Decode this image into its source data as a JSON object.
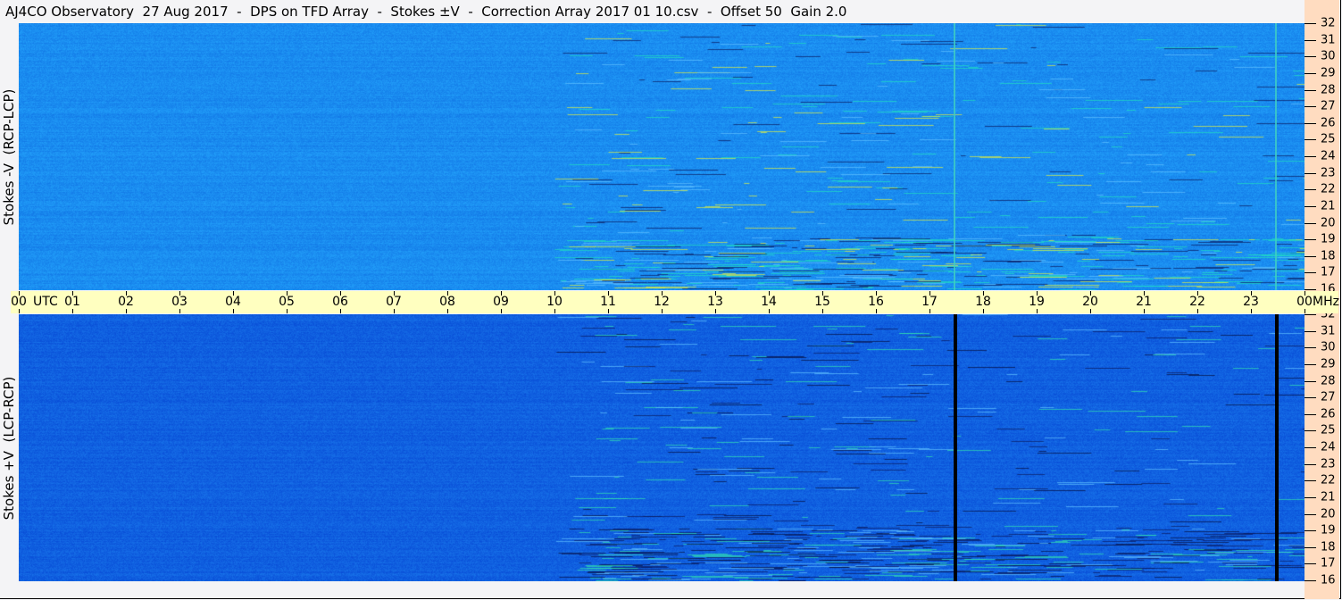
{
  "title": "AJ4CO Observatory  27 Aug 2017  -  DPS on TFD Array  -  Stokes ±V  -  Correction Array 2017 01 10.csv  -  Offset 50  Gain 2.0",
  "chart_data": {
    "type": "heatmap",
    "title": "AJ4CO Observatory  27 Aug 2017  -  DPS on TFD Array  -  Stokes ±V  -  Correction Array 2017 01 10.csv  -  Offset 50  Gain 2.0",
    "xlabel": "UTC",
    "ylabel_unit": "MHz",
    "xlim": [
      0,
      24
    ],
    "ylim": [
      16,
      32
    ],
    "x_ticks": [
      "00",
      "01",
      "02",
      "03",
      "04",
      "05",
      "06",
      "07",
      "08",
      "09",
      "10",
      "11",
      "12",
      "13",
      "14",
      "15",
      "16",
      "17",
      "18",
      "19",
      "20",
      "21",
      "22",
      "23",
      "00"
    ],
    "y_ticks": [
      "32",
      "31",
      "30",
      "29",
      "28",
      "27",
      "26",
      "25",
      "24",
      "23",
      "22",
      "21",
      "20",
      "19",
      "18",
      "17",
      "16"
    ],
    "panels": [
      {
        "ylabel": "Stokes -V  (RCP-LCP)",
        "base_color": "#1a8cf0",
        "vertical_lines_utc": [
          17.45,
          23.45
        ],
        "vertical_line_color": "#40d0c0"
      },
      {
        "ylabel": "Stokes +V  (LCP-RCP)",
        "base_color": "#1060e0",
        "vertical_lines_utc": [
          17.45,
          23.45
        ],
        "vertical_line_color": "#000000"
      }
    ],
    "grid": false
  },
  "colors": {
    "time_band": "#ffffc0",
    "freq_axis": "#ffdcc0",
    "background": "#f4f4f6"
  }
}
